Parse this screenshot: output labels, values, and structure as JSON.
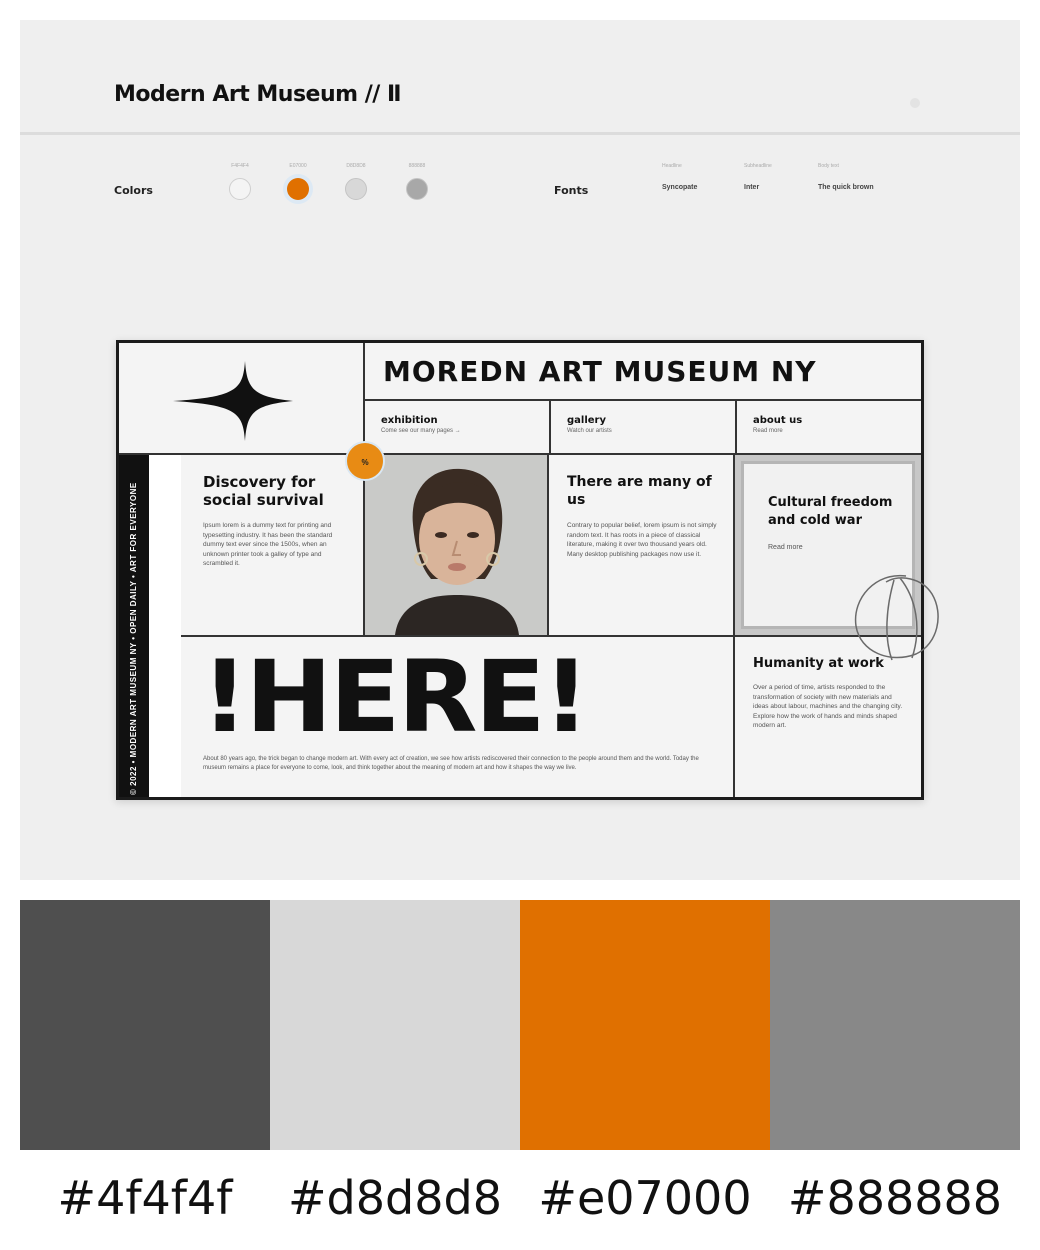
{
  "header": {
    "title": "Modern Art Museum // Ⅱ"
  },
  "meta": {
    "colors_label": "Colors",
    "swatches": [
      {
        "caption": "F4F4F4",
        "color": "#f4f4f4"
      },
      {
        "caption": "E07000",
        "color": "#e07000"
      },
      {
        "caption": "D8D8D8",
        "color": "#d8d8d8"
      },
      {
        "caption": "888888",
        "color": "#a8a8a8"
      }
    ],
    "fonts_label": "Fonts",
    "fonts": [
      {
        "caption": "Headline",
        "value": "Syncopate"
      },
      {
        "caption": "Subheadline",
        "value": "Inter"
      },
      {
        "caption": "Body text",
        "value": "The quick brown"
      }
    ]
  },
  "poster": {
    "title": "MOREDN ART MUSEUM NY",
    "nav": [
      {
        "title": "exhibition",
        "sub": "Come see our many pages →"
      },
      {
        "title": "gallery",
        "sub": "Watch our artists"
      },
      {
        "title": "about us",
        "sub": "Read more"
      }
    ],
    "vertical_text": "© 2022 • MODERN ART MUSEUM NY • OPEN DAILY • ART FOR EVERYONE",
    "badge": "%",
    "col1": {
      "heading": "Discovery for social survival",
      "body": "Ipsum lorem is a dummy text for printing and typesetting industry. It has been the standard dummy text ever since the 1500s, when an unknown printer took a galley of type and scrambled it."
    },
    "col3": {
      "heading": "There are many of us",
      "body": "Contrary to popular belief, lorem ipsum is not simply random text. It has roots in a piece of classical literature, making it over two thousand years old. Many desktop publishing packages now use it."
    },
    "col4": {
      "heading": "Cultural freedom and cold war",
      "link": "Read more"
    },
    "here": {
      "text": "!HERE!",
      "body": "About 80 years ago, the trick began to change modern art. With every act of creation, we see how artists rediscovered their connection to the people around them and the world. Today the museum remains a place for everyone to come, look, and think together about the meaning of modern art and how it shapes the way we live."
    },
    "col6": {
      "heading": "Humanity at work",
      "body": "Over a period of time, artists responded to the transformation of society with new materials and ideas about labour, machines and the changing city. Explore how the work of hands and minds shaped modern art."
    }
  },
  "palette": [
    {
      "hex": "#4f4f4f",
      "color": "#4f4f4f"
    },
    {
      "hex": "#d8d8d8",
      "color": "#d8d8d8"
    },
    {
      "hex": "#e07000",
      "color": "#e07000"
    },
    {
      "hex": "#888888",
      "color": "#888888"
    }
  ]
}
